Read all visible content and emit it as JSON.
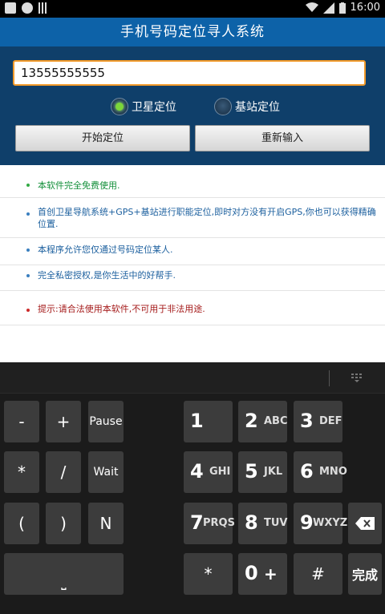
{
  "status_bar": {
    "time": "16:00"
  },
  "app": {
    "title": "手机号码定位寻人系统"
  },
  "phone_input": {
    "value": "13555555555"
  },
  "radios": [
    {
      "label": "卫星定位",
      "checked": true
    },
    {
      "label": "基站定位",
      "checked": false
    }
  ],
  "buttons": {
    "start": "开始定位",
    "reenter": "重新输入"
  },
  "notes": [
    {
      "text": "本软件完全免费使用.",
      "color": "#138f3a",
      "bullet": "#33aa44"
    },
    {
      "text": "首创卫星导航系统+GPS+基站进行职能定位,即时对方没有开启GPS,你也可以获得精确位置.",
      "color": "#1b5f9e",
      "bullet": "#3a7fbf"
    },
    {
      "text": "本程序允许您仅通过号码定位某人.",
      "color": "#1b5f9e",
      "bullet": "#3a7fbf"
    },
    {
      "text": "完全私密授权,是你生活中的好帮手.",
      "color": "#1b5f9e",
      "bullet": "#3a7fbf"
    },
    {
      "text": "提示:请合法使用本软件,不可用于非法用途.",
      "color": "#a51b1b",
      "bullet": "#cc2a2a"
    }
  ],
  "keyboard": {
    "symbol_keys": [
      "-",
      "+",
      "Pause",
      "*",
      "/",
      "Wait",
      "(",
      ")",
      "N"
    ],
    "space_label": "⎵",
    "digits": [
      {
        "num": "1",
        "letters": ""
      },
      {
        "num": "2",
        "letters": "ABC"
      },
      {
        "num": "3",
        "letters": "DEF"
      },
      {
        "num": "4",
        "letters": "GHI"
      },
      {
        "num": "5",
        "letters": "JKL"
      },
      {
        "num": "6",
        "letters": "MNO"
      },
      {
        "num": "7",
        "letters": "PRQS"
      },
      {
        "num": "8",
        "letters": "TUV"
      },
      {
        "num": "9",
        "letters": "WXYZ"
      }
    ],
    "star": "*",
    "zero": "0",
    "zero_extra": "+",
    "hash": "#",
    "done": "完成"
  }
}
